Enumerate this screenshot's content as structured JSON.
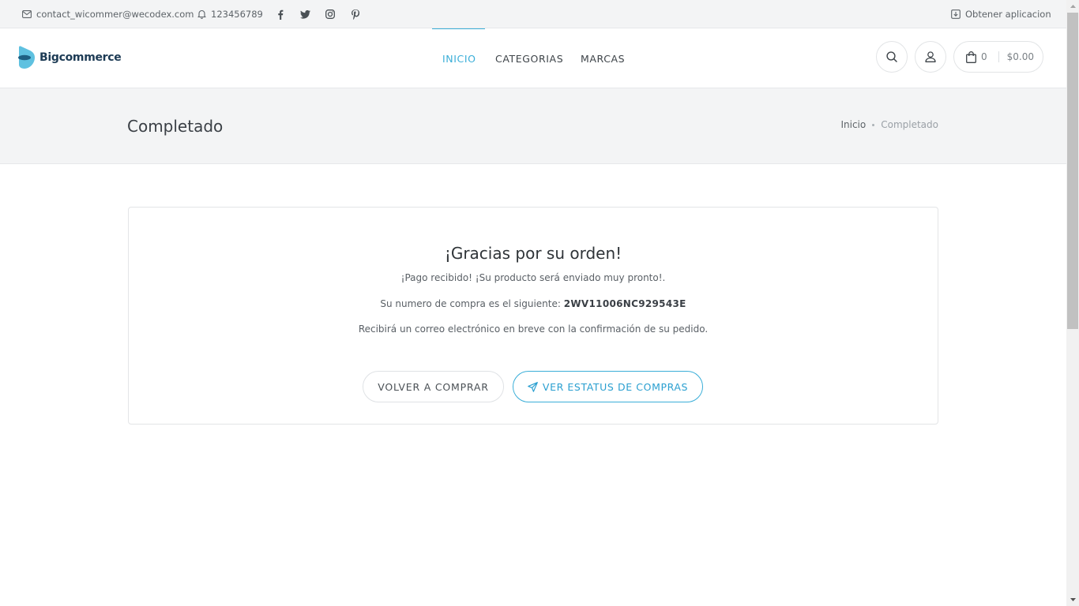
{
  "topbar": {
    "email": "contact_wicommer@wecodex.com",
    "phone": "123456789",
    "get_app": "Obtener aplicacion",
    "social": [
      "facebook-icon",
      "twitter-icon",
      "instagram-icon",
      "pinterest-icon"
    ]
  },
  "header": {
    "logo_text": "Bigcommerce",
    "nav": [
      {
        "label": "INICIO",
        "active": true
      },
      {
        "label": "CATEGORIAS",
        "active": false
      },
      {
        "label": "MARCAS",
        "active": false
      }
    ],
    "cart_count": "0",
    "cart_total": "$0.00"
  },
  "titleband": {
    "title": "Completado",
    "breadcrumb_home": "Inicio",
    "breadcrumb_current": "Completado"
  },
  "confirmation": {
    "heading": "¡Gracias por su orden!",
    "payment_received": "¡Pago recibido! ¡Su producto será enviado muy pronto!.",
    "order_prefix": "Su numero de compra es el siguiente:",
    "order_code": "2WV11006NC929543E",
    "email_notice": "Recibirá un correo electrónico en breve con la confirmación de su pedido.",
    "back_button": "VOLVER A COMPRAR",
    "status_button": "VER ESTATUS DE COMPRAS"
  },
  "colors": {
    "accent": "#3aaed8",
    "band": "#f3f4f5",
    "text": "#3a3f45"
  }
}
